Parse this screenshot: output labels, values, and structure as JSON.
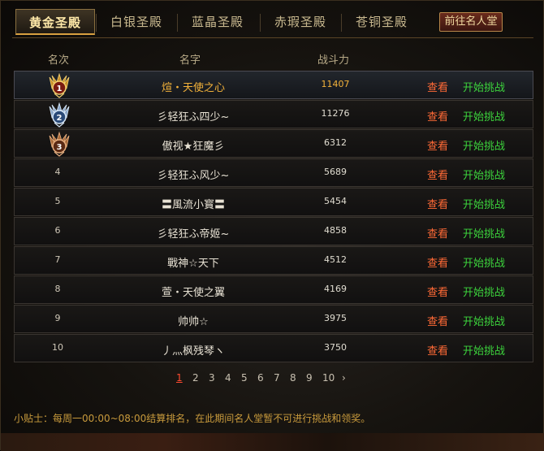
{
  "tabs": [
    {
      "label": "黄金圣殿",
      "active": true
    },
    {
      "label": "白银圣殿",
      "active": false
    },
    {
      "label": "蓝晶圣殿",
      "active": false
    },
    {
      "label": "赤瑕圣殿",
      "active": false
    },
    {
      "label": "苍铜圣殿",
      "active": false
    }
  ],
  "hall_button": "前往名人堂",
  "columns": {
    "rank": "名次",
    "name": "名字",
    "power": "战斗力"
  },
  "rows": [
    {
      "rank": "1",
      "medal": "gold",
      "name": "煊・天使之心",
      "power": "11407",
      "view": "查看",
      "fight": "开始挑战"
    },
    {
      "rank": "2",
      "medal": "silver",
      "name": "彡轻狂ふ四少~",
      "power": "11276",
      "view": "查看",
      "fight": "开始挑战"
    },
    {
      "rank": "3",
      "medal": "bronze",
      "name": "傲视★狂魔彡",
      "power": "6312",
      "view": "查看",
      "fight": "开始挑战"
    },
    {
      "rank": "4",
      "medal": "",
      "name": "彡轻狂ふ风少~",
      "power": "5689",
      "view": "查看",
      "fight": "开始挑战"
    },
    {
      "rank": "5",
      "medal": "",
      "name": "〓風流小寳〓",
      "power": "5454",
      "view": "查看",
      "fight": "开始挑战"
    },
    {
      "rank": "6",
      "medal": "",
      "name": "彡轻狂ふ帝姬~",
      "power": "4858",
      "view": "查看",
      "fight": "开始挑战"
    },
    {
      "rank": "7",
      "medal": "",
      "name": "戰神☆天下",
      "power": "4512",
      "view": "查看",
      "fight": "开始挑战"
    },
    {
      "rank": "8",
      "medal": "",
      "name": "萱・天使之翼",
      "power": "4169",
      "view": "查看",
      "fight": "开始挑战"
    },
    {
      "rank": "9",
      "medal": "",
      "name": "帅帅☆",
      "power": "3975",
      "view": "查看",
      "fight": "开始挑战"
    },
    {
      "rank": "10",
      "medal": "",
      "name": "丿灬枫残琴ヽ",
      "power": "3750",
      "view": "查看",
      "fight": "开始挑战"
    }
  ],
  "pagination": {
    "pages": [
      "1",
      "2",
      "3",
      "4",
      "5",
      "6",
      "7",
      "8",
      "9",
      "10"
    ],
    "current": "1",
    "next": "›"
  },
  "tip": "小贴士：每周一00:00~08:00结算排名，在此期间名人堂暂不可进行挑战和领奖。",
  "colors": {
    "gold": "#d8a040",
    "view": "#ff6a36",
    "fight": "#3cd23c",
    "top_name": "#f3b23a",
    "page_current": "#ff4a30"
  }
}
